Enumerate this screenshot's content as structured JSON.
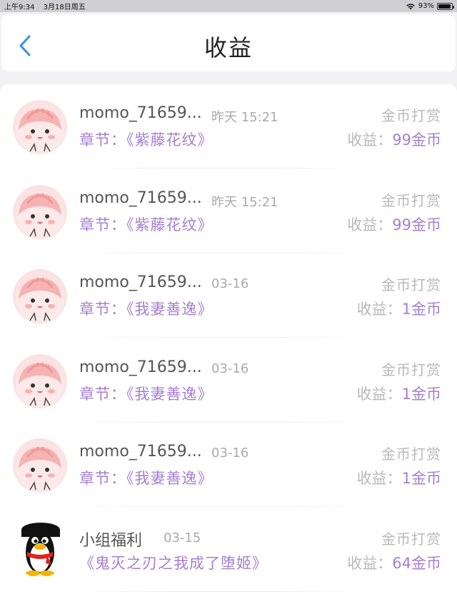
{
  "status_bar": {
    "time": "上午9:34",
    "date": "3月18日周五",
    "battery": "93%",
    "battery_level": 0.93
  },
  "header": {
    "title": "收益",
    "back_icon": "chevron-left-icon",
    "accent_color": "#3b8fe6"
  },
  "labels": {
    "chapter_prefix": "章节：",
    "earnings_prefix": "收益："
  },
  "colors": {
    "purple": "#a57fd0",
    "grey": "#b9b9b9"
  },
  "items": [
    {
      "avatar": "pink-blob-avatar",
      "name": "momo_71659...",
      "time": "昨天 15:21",
      "type": "金币打赏",
      "chapter": "《紫藤花纹》",
      "amount": "99金币"
    },
    {
      "avatar": "pink-blob-avatar",
      "name": "momo_71659...",
      "time": "昨天 15:21",
      "type": "金币打赏",
      "chapter": "《紫藤花纹》",
      "amount": "99金币"
    },
    {
      "avatar": "pink-blob-avatar",
      "name": "momo_71659...",
      "time": "03-16",
      "type": "金币打赏",
      "chapter": "《我妻善逸》",
      "amount": "1金币"
    },
    {
      "avatar": "pink-blob-avatar",
      "name": "momo_71659...",
      "time": "03-16",
      "type": "金币打赏",
      "chapter": "《我妻善逸》",
      "amount": "1金币"
    },
    {
      "avatar": "pink-blob-avatar",
      "name": "momo_71659...",
      "time": "03-16",
      "type": "金币打赏",
      "chapter": "《我妻善逸》",
      "amount": "1金币"
    },
    {
      "avatar": "penguin-avatar",
      "name": "小组福利",
      "time": "03-15",
      "type": "金币打赏",
      "chapter": "《鬼灭之刃之我成了堕姬》",
      "amount": "64金币"
    }
  ]
}
